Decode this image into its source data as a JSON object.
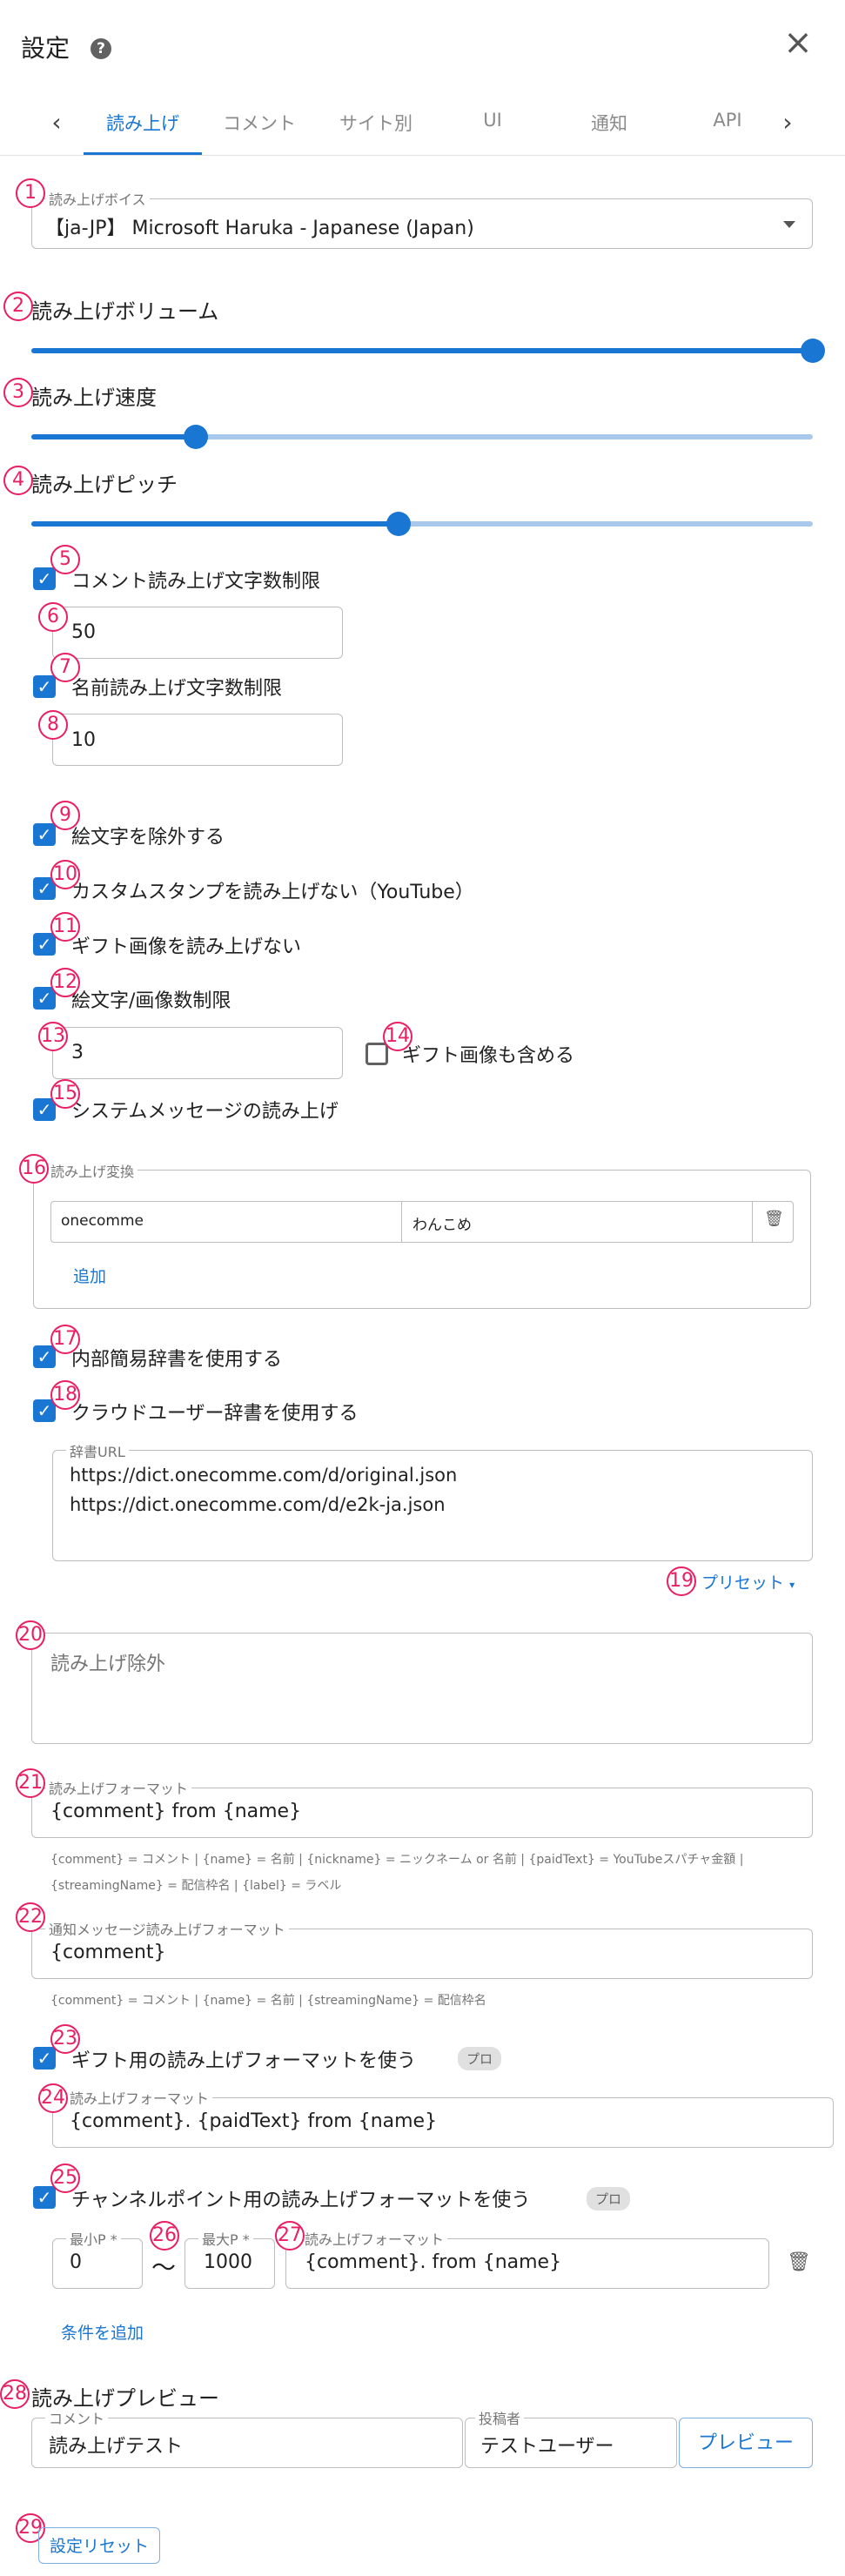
{
  "header": {
    "title": "設定",
    "help_icon": "?",
    "close_icon": "×"
  },
  "tabs": {
    "prev_icon": "‹",
    "next_icon": "›",
    "items": [
      "読み上げ",
      "コメント",
      "サイト別",
      "UI",
      "通知",
      "API"
    ]
  },
  "badges": [
    "1",
    "2",
    "3",
    "4",
    "5",
    "6",
    "7",
    "8",
    "9",
    "10",
    "11",
    "12",
    "13",
    "14",
    "15",
    "16",
    "17",
    "18",
    "19",
    "20",
    "21",
    "22",
    "23",
    "24",
    "25",
    "26",
    "27",
    "28",
    "29"
  ],
  "voice": {
    "label": "読み上げボイス",
    "value": "【ja-JP】 Microsoft Haruka - Japanese (Japan)"
  },
  "volume": {
    "label": "読み上げボリューム",
    "level": 1.0
  },
  "speed": {
    "label": "読み上げ速度",
    "level": 0.21
  },
  "pitch": {
    "label": "読み上げピッチ",
    "level": 0.47
  },
  "comment_limit": {
    "label": "コメント読み上げ文字数制限",
    "value": "50"
  },
  "name_limit": {
    "label": "名前読み上げ文字数制限",
    "value": "10"
  },
  "exclude_emoji": {
    "label": "絵文字を除外する"
  },
  "no_custom_stamp": {
    "label": "カスタムスタンプを読み上げない（YouTube）"
  },
  "no_gift_image": {
    "label": "ギフト画像を読み上げない"
  },
  "emoji_limit": {
    "label": "絵文字/画像数制限",
    "value": "3",
    "include_gift_label": "ギフト画像も含める"
  },
  "system_message": {
    "label": "システムメッセージの読み上げ"
  },
  "conversion": {
    "label": "読み上げ変換",
    "rows": [
      {
        "from": "onecomme",
        "to": "わんこめ"
      }
    ],
    "add_label": "追加"
  },
  "internal_dict": {
    "label": "内部簡易辞書を使用する"
  },
  "cloud_dict": {
    "label": "クラウドユーザー辞書を使用する",
    "url_label": "辞書URL",
    "urls": [
      "https://dict.onecomme.com/d/original.json",
      "https://dict.onecomme.com/d/e2k-ja.json"
    ]
  },
  "preset": {
    "label": "プリセット"
  },
  "exclusion": {
    "placeholder": "読み上げ除外"
  },
  "format": {
    "label": "読み上げフォーマット",
    "value": "{comment} from {name}",
    "hint1": "{comment} = コメント | {name} = 名前 | {nickname} = ニックネーム or 名前 | {paidText} = YouTubeスパチャ金額 |",
    "hint2": "{streamingName} = 配信枠名 | {label} = ラベル"
  },
  "notify_format": {
    "label": "通知メッセージ読み上げフォーマット",
    "value": "{comment}",
    "hint": "{comment} = コメント | {name} = 名前 | {streamingName} = 配信枠名"
  },
  "gift_format": {
    "check_label": "ギフト用の読み上げフォーマットを使う",
    "pro": "プロ",
    "label": "読み上げフォーマット",
    "value": "{comment}. {paidText} from {name}"
  },
  "channel_format": {
    "check_label": "チャンネルポイント用の読み上げフォーマットを使う",
    "pro": "プロ",
    "min_label": "最小P *",
    "min_value": "0",
    "tilde": "〜",
    "max_label": "最大P *",
    "max_value": "1000",
    "label": "読み上げフォーマット",
    "value": "{comment}. from {name}",
    "add_condition": "条件を追加"
  },
  "preview": {
    "label": "読み上げプレビュー",
    "comment_label": "コメント",
    "comment_value": "読み上げテスト",
    "author_label": "投稿者",
    "author_value": "テストユーザー",
    "button": "プレビュー"
  },
  "reset": {
    "button": "設定リセット"
  },
  "colors": {
    "accent": "#1976d2",
    "badge": "#e91e63"
  }
}
